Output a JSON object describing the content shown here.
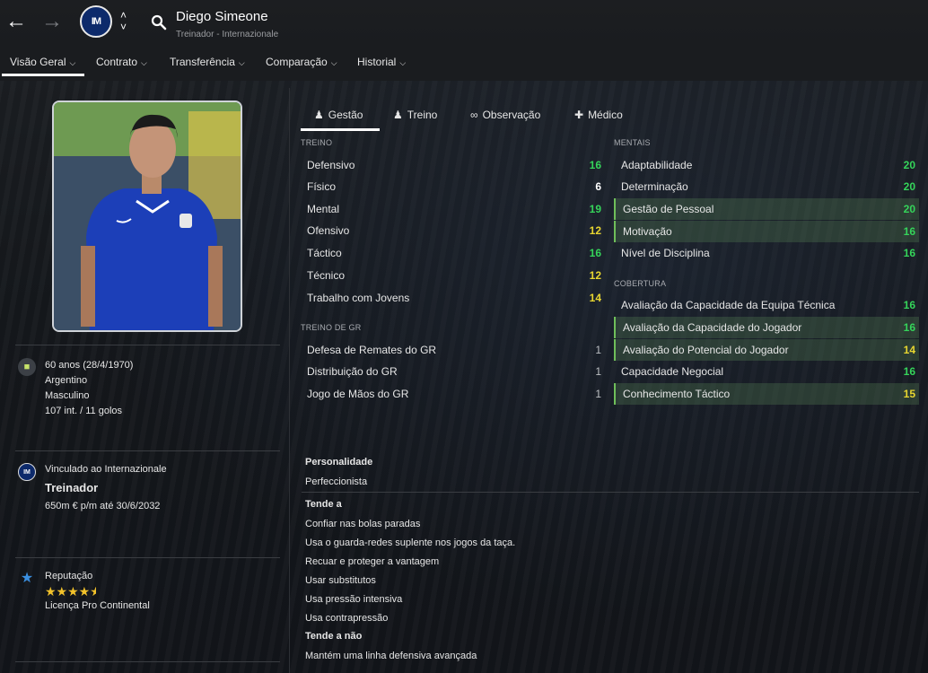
{
  "header": {
    "name": "Diego Simeone",
    "subtitle": "Treinador - Internazionale",
    "back_icon": "arrow-left-icon",
    "forward_icon": "arrow-right-icon",
    "club_badge_text": "IM"
  },
  "tabs": [
    {
      "label": "Visão Geral"
    },
    {
      "label": "Contrato"
    },
    {
      "label": "Transferência"
    },
    {
      "label": "Comparação"
    },
    {
      "label": "Historial"
    }
  ],
  "left": {
    "age": "60 anos (28/4/1970)",
    "nationality": "Argentino",
    "gender": "Masculino",
    "caps": "107 int. / 11 golos",
    "contract_club": "Vinculado ao Internazionale",
    "role": "Treinador",
    "wage": "650m € p/m até 30/6/2032",
    "reputation_label": "Reputação",
    "reputation_stars": 4.5,
    "license": "Licença Pro Continental"
  },
  "subtabs": [
    {
      "label": "Gestão",
      "icon": "person-icon"
    },
    {
      "label": "Treino",
      "icon": "training-icon"
    },
    {
      "label": "Observação",
      "icon": "binoculars-icon"
    },
    {
      "label": "Médico",
      "icon": "medical-icon"
    }
  ],
  "sections": {
    "treino": "TREINO",
    "treino_gr": "TREINO DE GR",
    "mentais": "MENTAIS",
    "cobertura": "COBERTURA"
  },
  "treino": [
    {
      "label": "Defensivo",
      "value": "16"
    },
    {
      "label": "Físico",
      "value": "6"
    },
    {
      "label": "Mental",
      "value": "19"
    },
    {
      "label": "Ofensivo",
      "value": "12"
    },
    {
      "label": "Táctico",
      "value": "16"
    },
    {
      "label": "Técnico",
      "value": "12"
    },
    {
      "label": "Trabalho com Jovens",
      "value": "14"
    }
  ],
  "treino_gr": [
    {
      "label": "Defesa de Remates do GR",
      "value": "1"
    },
    {
      "label": "Distribuição do GR",
      "value": "1"
    },
    {
      "label": "Jogo de Mãos do GR",
      "value": "1"
    }
  ],
  "mentais": [
    {
      "label": "Adaptabilidade",
      "value": "20"
    },
    {
      "label": "Determinação",
      "value": "20"
    },
    {
      "label": "Gestão de Pessoal",
      "value": "20"
    },
    {
      "label": "Motivação",
      "value": "16"
    },
    {
      "label": "Nível de Disciplina",
      "value": "16"
    }
  ],
  "cobertura": [
    {
      "label": "Avaliação da Capacidade da Equipa Técnica",
      "value": "16"
    },
    {
      "label": "Avaliação da Capacidade do Jogador",
      "value": "16"
    },
    {
      "label": "Avaliação do Potencial do Jogador",
      "value": "14"
    },
    {
      "label": "Capacidade Negocial",
      "value": "16"
    },
    {
      "label": "Conhecimento Táctico",
      "value": "15"
    }
  ],
  "personality": {
    "label": "Personalidade",
    "value": "Perfeccionista",
    "tends_label": "Tende a",
    "tends": [
      "Confiar nas bolas paradas",
      "Usa o guarda-redes suplente nos jogos da taça.",
      "Recuar e proteger a vantagem",
      "Usar substitutos",
      "Usa pressão intensiva",
      "Usa contrapressão"
    ],
    "not_tends_label": "Tende a não",
    "not_tends": [
      "Mantém uma linha defensiva avançada"
    ]
  },
  "colors": {
    "green": "#35d45a",
    "yellow": "#e8d630",
    "highlight": "#3f5a3f"
  }
}
